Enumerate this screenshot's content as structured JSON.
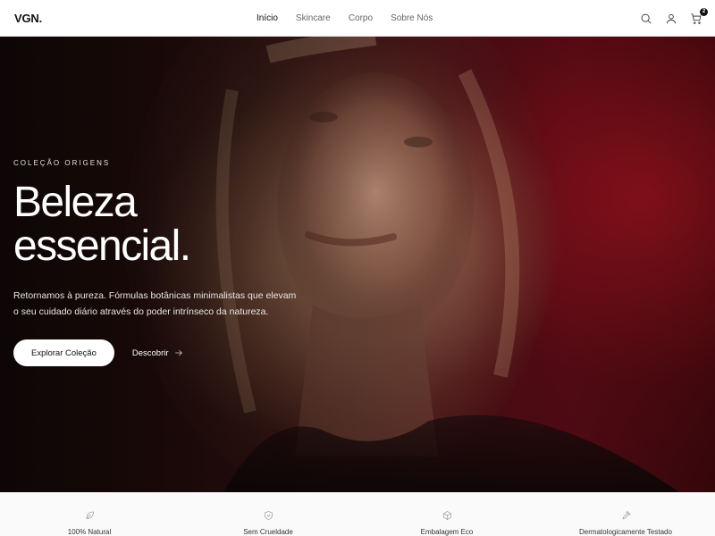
{
  "header": {
    "logo": "VGN.",
    "nav": [
      {
        "label": "Início",
        "active": true
      },
      {
        "label": "Skincare",
        "active": false
      },
      {
        "label": "Corpo",
        "active": false
      },
      {
        "label": "Sobre Nós",
        "active": false
      }
    ],
    "icons": [
      "search-icon",
      "user-icon",
      "cart-icon"
    ],
    "cart_count": "2"
  },
  "hero": {
    "eyebrow": "COLEÇÃO ORIGENS",
    "headline_line1": "Beleza",
    "headline_line2": "essencial.",
    "lead_line1": "Retornamos à pureza. Fórmulas botânicas minimalistas que elevam",
    "lead_line2": "o seu cuidado diário através do poder intrínseco da natureza.",
    "primary_cta": "Explorar Coleção",
    "secondary_cta": "Descobrir",
    "accent": "#4a0a14"
  },
  "features": [
    {
      "label": "100% Natural",
      "icon": "leaf-icon"
    },
    {
      "label": "Sem Crueldade",
      "icon": "shield-check-icon"
    },
    {
      "label": "Embalagem Eco",
      "icon": "box-icon"
    },
    {
      "label": "Dermatologicamente Testado",
      "icon": "dropper-icon"
    }
  ]
}
